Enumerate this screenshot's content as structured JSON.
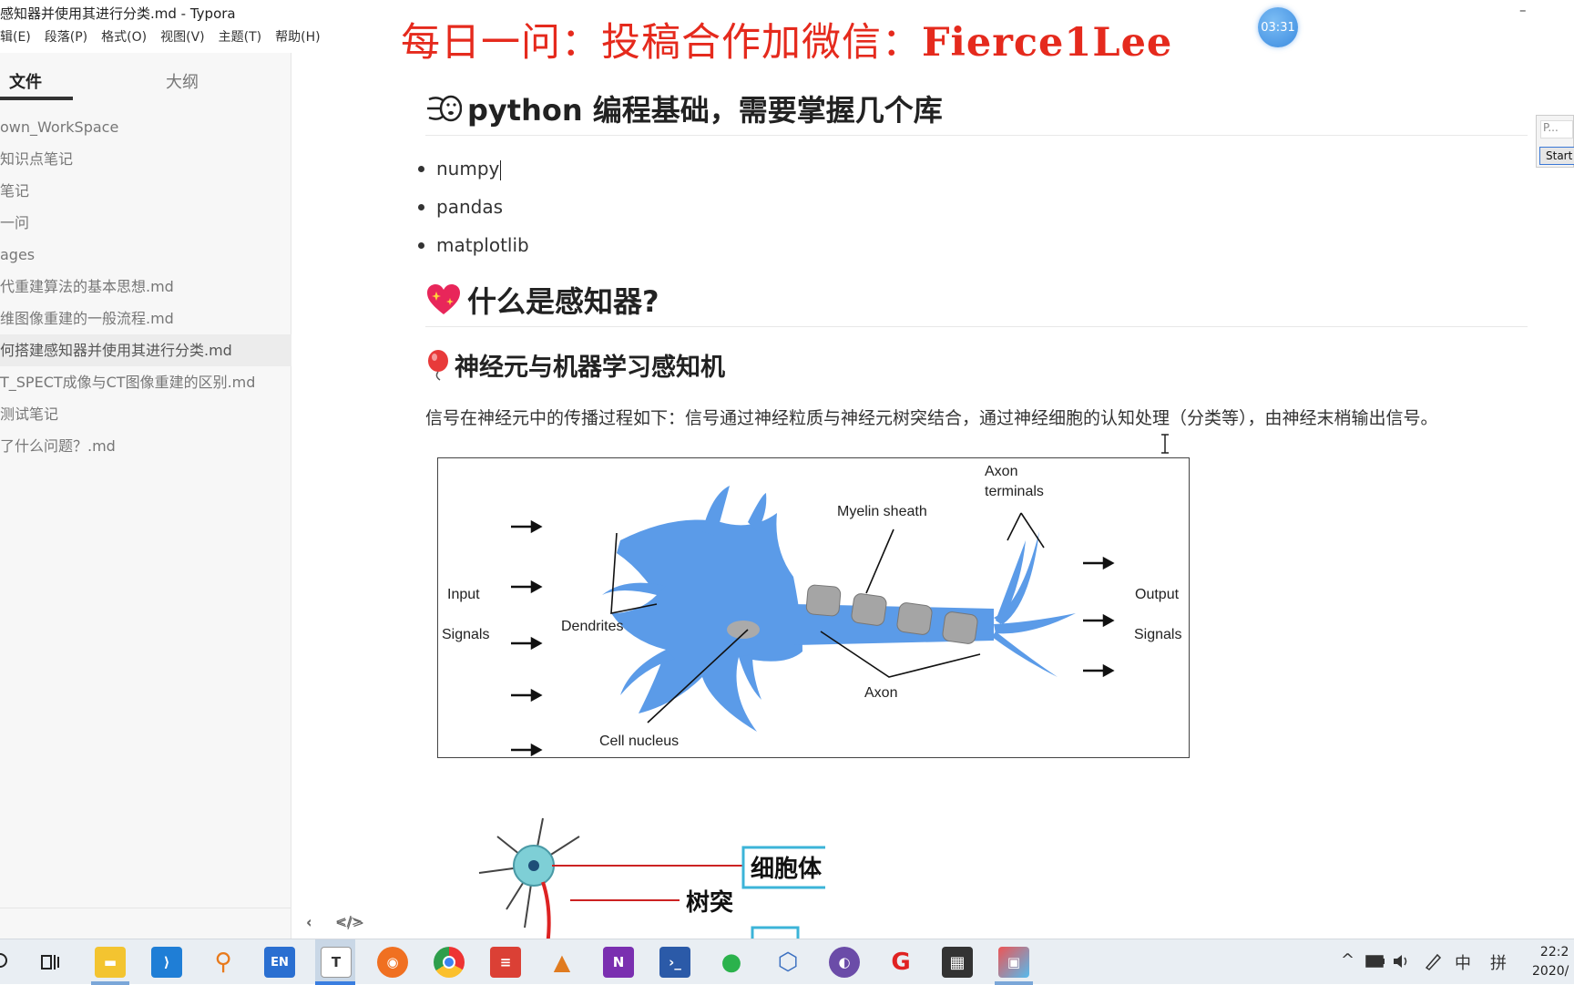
{
  "window": {
    "title": "感知器并使用其进行分类.md - Typora",
    "minimize_glyph": "–"
  },
  "menu": [
    "辑(E)",
    "段落(P)",
    "格式(O)",
    "视图(V)",
    "主题(T)",
    "帮助(H)"
  ],
  "watermark": {
    "prefix": "每日一问：投稿合作加微信：",
    "name": "Fierce1Lee"
  },
  "timer": "03:31",
  "sidebar": {
    "tab_files": "文件",
    "tab_outline": "大纲",
    "files": [
      "own_WorkSpace",
      "知识点笔记",
      "笔记",
      "一问",
      "ages",
      "代重建算法的基本思想.md",
      "维图像重建的一般流程.md",
      "何搭建感知器并使用其进行分类.md",
      "T_SPECT成像与CT图像重建的区别.md",
      "测试笔记",
      "了什么问题？.md"
    ],
    "active_index": 7,
    "footer_back": "‹",
    "footer_source": "</>"
  },
  "doc": {
    "h2_python": "python 编程基础，需要掌握几个库",
    "python_icon": "wind-face-icon",
    "libs": [
      "numpy",
      "pandas",
      "matplotlib"
    ],
    "h2_perceptron": "什么是感知器?",
    "perceptron_icon": "sparkling-heart-icon",
    "h3_neuron": "神经元与机器学习感知机",
    "neuron_icon": "balloon-icon",
    "paragraph": "信号在神经元中的传播过程如下：信号通过神经粒质与神经元树突结合，通过神经细胞的认知处理（分类等），由神经末梢输出信号。",
    "figure": {
      "input_label_1": "Input",
      "input_label_2": "Signals",
      "dendrites": "Dendrites",
      "myelin": "Myelin sheath",
      "axon_terminals_1": "Axon",
      "axon_terminals_2": "terminals",
      "output_label_1": "Output",
      "output_label_2": "Signals",
      "axon": "Axon",
      "nucleus": "Cell nucleus"
    },
    "figure2": {
      "label_cell_body": "细胞体",
      "label_dendrite": "树突"
    }
  },
  "right_widget": {
    "input_text": "P...",
    "button": "Start"
  },
  "taskbar": {
    "apps": [
      "start",
      "task-view",
      "file-explorer",
      "vscode",
      "everything-search",
      "en-ime",
      "typora",
      "firefox",
      "chrome",
      "todoist",
      "matlab",
      "onenote",
      "powershell",
      "wechat",
      "virtualbox",
      "github-desktop",
      "app-red",
      "calculator",
      "photos"
    ],
    "tray": {
      "chevron": "^",
      "ime": "中",
      "layout": "拼"
    },
    "clock_time": "22:2",
    "clock_date": "2020/"
  },
  "colors": {
    "watermark": "#e52a1d",
    "neuron_blue": "#5b9be8",
    "taskbar": "#e9eef3"
  }
}
